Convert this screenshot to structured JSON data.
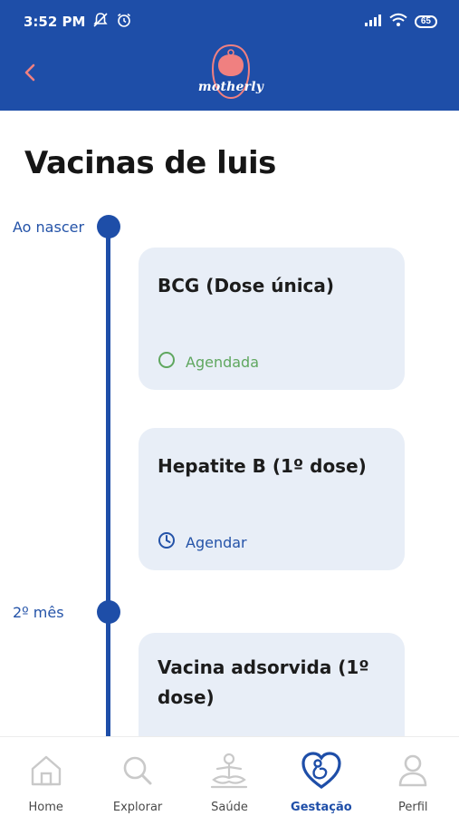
{
  "status_bar": {
    "time": "3:52 PM",
    "icons": [
      "notifications-off-icon",
      "alarm-icon"
    ],
    "right_icons": [
      "signal-icon",
      "wifi-icon"
    ],
    "battery": "65"
  },
  "app_bar": {
    "back_icon": "chevron-left-icon",
    "logo_text": "motherly",
    "colors": {
      "primary": "#1e4ea8",
      "accent": "#f08080"
    }
  },
  "page": {
    "title": "Vacinas de luis"
  },
  "timeline": [
    {
      "label": "Ao nascer",
      "vaccines": [
        {
          "name": "BCG (Dose única)",
          "status": "Agendada",
          "status_icon": "circle-check-icon",
          "status_color": "#5fa75f"
        },
        {
          "name": "Hepatite B (1º dose)",
          "status": "Agendar",
          "status_icon": "clock-icon",
          "status_color": "#2453a8"
        }
      ]
    },
    {
      "label": "2º mês",
      "vaccines": [
        {
          "name": "Vacina adsorvida (1º dose)"
        }
      ]
    }
  ],
  "bottom_nav": {
    "items": [
      {
        "label": "Home",
        "icon": "home-icon"
      },
      {
        "label": "Explorar",
        "icon": "search-icon"
      },
      {
        "label": "Saúde",
        "icon": "meditation-icon"
      },
      {
        "label": "Gestação",
        "icon": "pregnancy-icon",
        "active": true
      },
      {
        "label": "Perfil",
        "icon": "profile-icon"
      }
    ]
  }
}
